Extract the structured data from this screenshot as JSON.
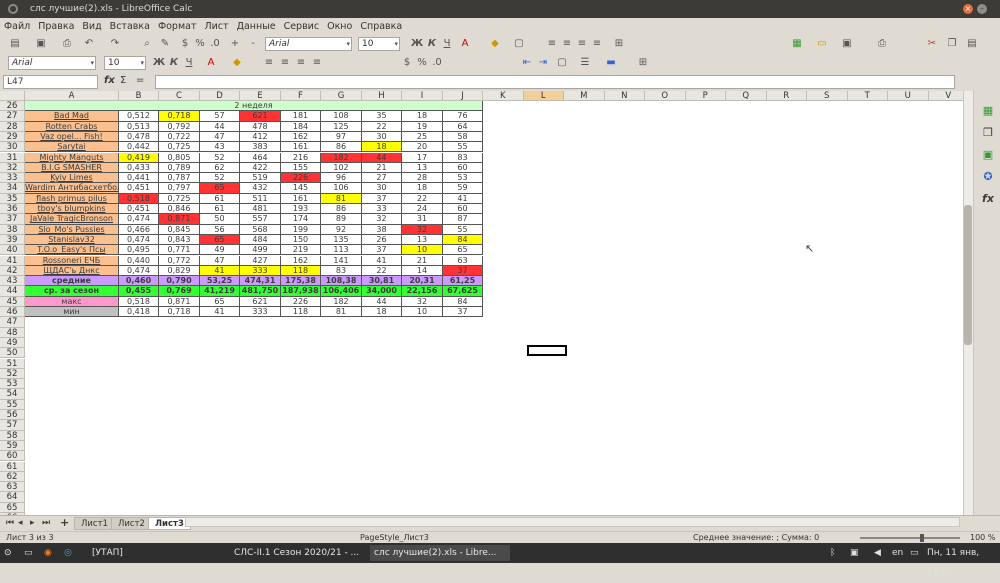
{
  "window": {
    "title": "слс лучшие(2).xls - LibreOffice Calc"
  },
  "menu": [
    "Файл",
    "Правка",
    "Вид",
    "Вставка",
    "Формат",
    "Лист",
    "Данные",
    "Сервис",
    "Окно",
    "Справка"
  ],
  "toolbar1": {
    "font": "Arial",
    "size": "10"
  },
  "toolbar2": {
    "font": "Arial",
    "size": "10"
  },
  "formula": {
    "cell_ref": "L47",
    "fx": "fx",
    "sum": "Σ",
    "eq": "=",
    "value": ""
  },
  "columns": [
    "A",
    "B",
    "C",
    "D",
    "E",
    "F",
    "G",
    "H",
    "I",
    "J",
    "K",
    "L",
    "M",
    "N",
    "O",
    "P",
    "Q",
    "R",
    "S",
    "T",
    "U",
    "V"
  ],
  "selected_column": "L",
  "rows": [
    26,
    27,
    28,
    29,
    30,
    31,
    32,
    33,
    34,
    35,
    36,
    37,
    38,
    39,
    40,
    41,
    42,
    43,
    44,
    45,
    46,
    47,
    48,
    49,
    50,
    51,
    52,
    53,
    54,
    55,
    56,
    57,
    58,
    59,
    60,
    61,
    62,
    63,
    64,
    65,
    66
  ],
  "week_header": "2 неделя",
  "table": [
    [
      "Bad Mad",
      "0,512",
      "0,718",
      "57",
      "621",
      "181",
      "108",
      "35",
      "18",
      "76"
    ],
    [
      "Rotten Crabs",
      "0,513",
      "0,792",
      "44",
      "478",
      "184",
      "125",
      "22",
      "19",
      "64"
    ],
    [
      "Vaz opel... Fish!",
      "0,478",
      "0,722",
      "47",
      "412",
      "162",
      "97",
      "30",
      "25",
      "58"
    ],
    [
      "Sarytai",
      "0,442",
      "0,725",
      "43",
      "383",
      "161",
      "86",
      "18",
      "20",
      "55"
    ],
    [
      "Mighty Manguts",
      "0,419",
      "0,805",
      "52",
      "464",
      "216",
      "182",
      "44",
      "17",
      "83"
    ],
    [
      "B.I.G SMASHER",
      "0,433",
      "0,789",
      "62",
      "422",
      "155",
      "102",
      "21",
      "13",
      "60"
    ],
    [
      "Kyiv Limes",
      "0,441",
      "0,787",
      "52",
      "519",
      "226",
      "96",
      "27",
      "28",
      "53"
    ],
    [
      "Wardim Антибасхетбол",
      "0,451",
      "0,797",
      "65",
      "432",
      "145",
      "106",
      "30",
      "18",
      "59"
    ],
    [
      "flash primus pilus",
      "0,518",
      "0,725",
      "61",
      "511",
      "161",
      "81",
      "37",
      "22",
      "41"
    ],
    [
      "tboy's blumpkins",
      "0,451",
      "0,846",
      "61",
      "481",
      "193",
      "86",
      "33",
      "24",
      "60"
    ],
    [
      "JaVale TragicBronson",
      "0,474",
      "0,871",
      "50",
      "557",
      "174",
      "89",
      "32",
      "31",
      "87"
    ],
    [
      "Slo_Mo's Pussies",
      "0,466",
      "0,845",
      "56",
      "568",
      "199",
      "92",
      "38",
      "32",
      "55"
    ],
    [
      "Stanislav32",
      "0,474",
      "0,843",
      "65",
      "484",
      "150",
      "135",
      "26",
      "13",
      "84"
    ],
    [
      "T.O.o_Easy's Псы",
      "0,495",
      "0,771",
      "49",
      "499",
      "219",
      "113",
      "37",
      "10",
      "65"
    ],
    [
      "Rossoneri ЕЧБ",
      "0,440",
      "0,772",
      "47",
      "427",
      "162",
      "141",
      "41",
      "21",
      "63"
    ],
    [
      "ЩДАС'ь Днкс",
      "0,474",
      "0,829",
      "41",
      "333",
      "118",
      "83",
      "22",
      "14",
      "37"
    ]
  ],
  "highlights": {
    "yellow": [
      [
        0,
        2
      ],
      [
        3,
        7
      ],
      [
        4,
        1
      ],
      [
        8,
        6
      ],
      [
        13,
        8
      ],
      [
        12,
        9
      ],
      [
        15,
        3
      ],
      [
        15,
        4
      ],
      [
        15,
        5
      ]
    ],
    "red": [
      [
        0,
        4
      ],
      [
        4,
        6
      ],
      [
        4,
        7
      ],
      [
        6,
        5
      ],
      [
        7,
        3
      ],
      [
        8,
        1
      ],
      [
        10,
        2
      ],
      [
        11,
        8
      ],
      [
        12,
        3
      ],
      [
        15,
        9
      ]
    ]
  },
  "summary": [
    {
      "label": "средние",
      "vals": [
        "0,460",
        "0,790",
        "53,25",
        "474,31",
        "175,38",
        "108,38",
        "30,81",
        "20,31",
        "61,25"
      ],
      "color": "#cc99ff"
    },
    {
      "label": "ср. за сезон",
      "vals": [
        "0,455",
        "0,769",
        "41,219",
        "481,750",
        "187,938",
        "106,406",
        "34,000",
        "22,156",
        "67,625"
      ],
      "color": "#33ff33"
    },
    {
      "label": "макс",
      "vals": [
        "0,518",
        "0,871",
        "65",
        "621",
        "226",
        "182",
        "44",
        "32",
        "84"
      ],
      "color": "#ff99cc"
    },
    {
      "label": "мин",
      "vals": [
        "0,418",
        "0,718",
        "41",
        "333",
        "118",
        "81",
        "18",
        "10",
        "37"
      ],
      "color": "#c0c0c0"
    }
  ],
  "sheets": [
    "Лист1",
    "Лист2",
    "Лист3"
  ],
  "active_sheet": "Лист3",
  "status": {
    "sheet": "Лист 3 из 3",
    "style": "PageStyle_Лист3",
    "summary": "Среднее значение: ; Сумма: 0",
    "zoom": "100 %"
  },
  "taskbar": {
    "app1": "[УТАП]",
    "app2": "СЛС-II.1 Сезон 2020/21 - ...",
    "app3": "слс лучшие(2).xls - Libre...",
    "lang": "en",
    "clock": "Пн, 11 янв, 11:50"
  }
}
